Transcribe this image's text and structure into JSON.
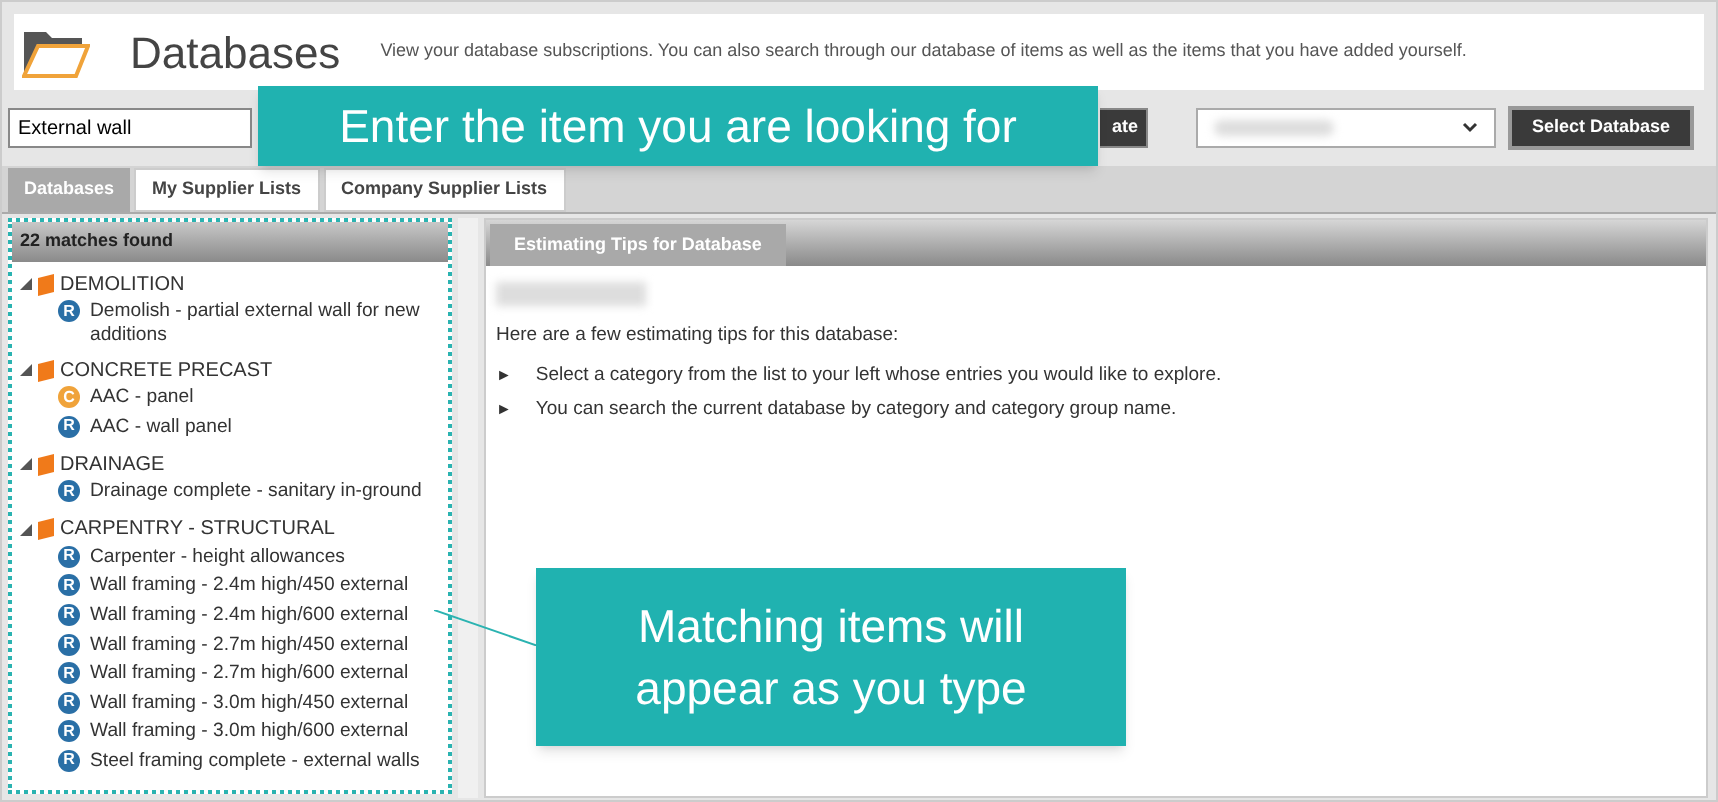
{
  "header": {
    "title": "Databases",
    "description": "View your database subscriptions. You can also search through our database of items as well as the items that you have added yourself."
  },
  "search": {
    "value": "External wall",
    "button": "ate"
  },
  "select_database": {
    "button": "Select Database"
  },
  "tabs": [
    {
      "label": "Databases",
      "selected": true
    },
    {
      "label": "My Supplier Lists",
      "selected": false
    },
    {
      "label": "Company Supplier Lists",
      "selected": false
    }
  ],
  "results": {
    "header": "22 matches found",
    "categories": [
      {
        "name": "DEMOLITION",
        "expanded": true,
        "children": [
          {
            "badge": "R",
            "color": "#2a6fa6",
            "name": "Demolish - partial external wall for new additions"
          }
        ]
      },
      {
        "name": "CONCRETE PRECAST",
        "expanded": true,
        "children": [
          {
            "badge": "C",
            "color": "#f0a33a",
            "name": "AAC - panel"
          },
          {
            "badge": "R",
            "color": "#2a6fa6",
            "name": "AAC - wall panel"
          }
        ]
      },
      {
        "name": "DRAINAGE",
        "expanded": true,
        "children": [
          {
            "badge": "R",
            "color": "#2a6fa6",
            "name": "Drainage complete - sanitary in-ground"
          }
        ]
      },
      {
        "name": "CARPENTRY - STRUCTURAL",
        "expanded": true,
        "children": [
          {
            "badge": "R",
            "color": "#2a6fa6",
            "name": "Carpenter - height allowances"
          },
          {
            "badge": "R",
            "color": "#2a6fa6",
            "name": "Wall framing - 2.4m high/450 external"
          },
          {
            "badge": "R",
            "color": "#2a6fa6",
            "name": "Wall framing - 2.4m high/600 external"
          },
          {
            "badge": "R",
            "color": "#2a6fa6",
            "name": "Wall framing - 2.7m high/450 external"
          },
          {
            "badge": "R",
            "color": "#2a6fa6",
            "name": "Wall framing - 2.7m high/600 external"
          },
          {
            "badge": "R",
            "color": "#2a6fa6",
            "name": "Wall framing - 3.0m high/450 external"
          },
          {
            "badge": "R",
            "color": "#2a6fa6",
            "name": "Wall framing - 3.0m high/600 external"
          },
          {
            "badge": "R",
            "color": "#2a6fa6",
            "name": "Steel framing complete - external walls"
          }
        ]
      }
    ]
  },
  "tips": {
    "tab": "Estimating Tips for Database",
    "intro": "Here are a few estimating tips for this database:",
    "bullet": "►",
    "items": [
      "Select a category from the list to your left whose entries you would like to explore.",
      "You can search the current database by category and category group name."
    ]
  },
  "callouts": [
    "Enter the item you are looking for",
    "Matching items will appear as you type"
  ]
}
